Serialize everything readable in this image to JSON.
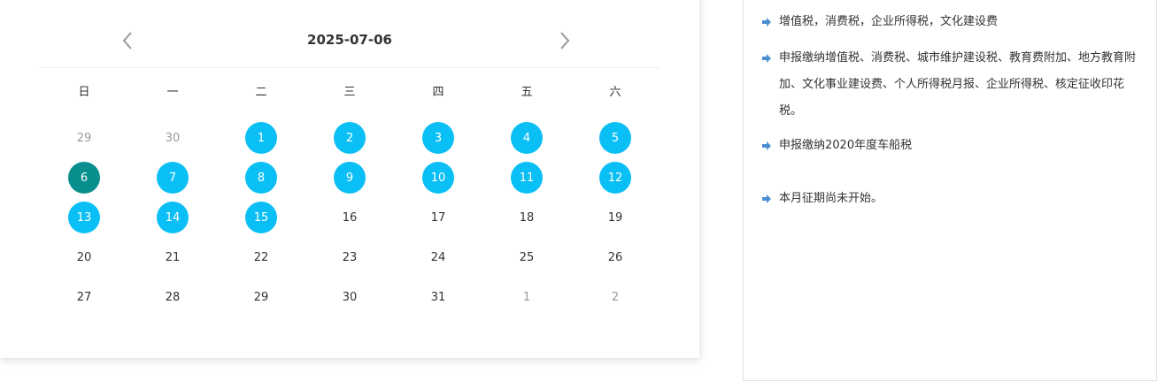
{
  "calendar": {
    "title": "2025-07-06",
    "weekdays": [
      "日",
      "一",
      "二",
      "三",
      "四",
      "五",
      "六"
    ],
    "weeks": [
      [
        {
          "label": "29",
          "state": "other"
        },
        {
          "label": "30",
          "state": "other"
        },
        {
          "label": "1",
          "state": "marked"
        },
        {
          "label": "2",
          "state": "marked"
        },
        {
          "label": "3",
          "state": "marked"
        },
        {
          "label": "4",
          "state": "marked"
        },
        {
          "label": "5",
          "state": "marked"
        }
      ],
      [
        {
          "label": "6",
          "state": "today"
        },
        {
          "label": "7",
          "state": "marked"
        },
        {
          "label": "8",
          "state": "marked"
        },
        {
          "label": "9",
          "state": "marked"
        },
        {
          "label": "10",
          "state": "marked"
        },
        {
          "label": "11",
          "state": "marked"
        },
        {
          "label": "12",
          "state": "marked"
        }
      ],
      [
        {
          "label": "13",
          "state": "marked"
        },
        {
          "label": "14",
          "state": "marked"
        },
        {
          "label": "15",
          "state": "marked"
        },
        {
          "label": "16",
          "state": "normal"
        },
        {
          "label": "17",
          "state": "normal"
        },
        {
          "label": "18",
          "state": "normal"
        },
        {
          "label": "19",
          "state": "normal"
        }
      ],
      [
        {
          "label": "20",
          "state": "normal"
        },
        {
          "label": "21",
          "state": "normal"
        },
        {
          "label": "22",
          "state": "normal"
        },
        {
          "label": "23",
          "state": "normal"
        },
        {
          "label": "24",
          "state": "normal"
        },
        {
          "label": "25",
          "state": "normal"
        },
        {
          "label": "26",
          "state": "normal"
        }
      ],
      [
        {
          "label": "27",
          "state": "normal"
        },
        {
          "label": "28",
          "state": "normal"
        },
        {
          "label": "29",
          "state": "normal"
        },
        {
          "label": "30",
          "state": "normal"
        },
        {
          "label": "31",
          "state": "normal"
        },
        {
          "label": "1",
          "state": "other"
        },
        {
          "label": "2",
          "state": "other"
        }
      ]
    ],
    "icons": {
      "prev": "chevron-left-icon",
      "next": "chevron-right-icon"
    },
    "colors": {
      "marked": "#0abff5",
      "today": "#0a8f8f",
      "other": "#999999"
    }
  },
  "info": {
    "bullet_icon": "arrow-right-icon",
    "bullet_color": "#4a8fd4",
    "items": [
      "增值税，消费税，企业所得税，文化建设费",
      "申报缴纳增值税、消费税、城市维护建设税、教育费附加、地方教育附加、文化事业建设费、个人所得税月报、企业所得税、核定征收印花税。",
      "申报缴纳2020年度车船税",
      "本月征期尚未开始。"
    ]
  }
}
